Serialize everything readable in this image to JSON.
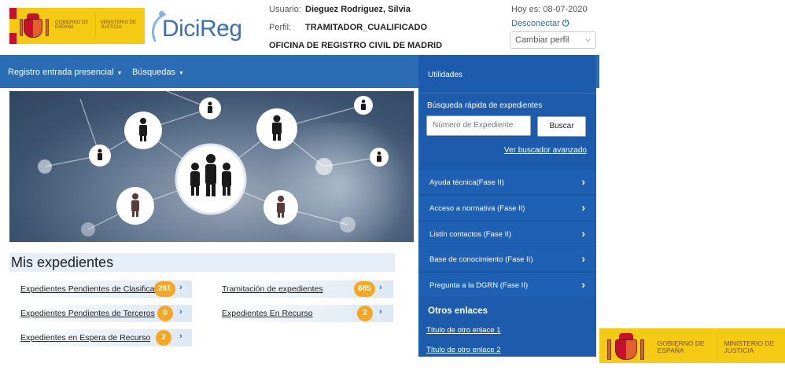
{
  "header": {
    "gov_logo": {
      "text_left": "GOBIERNO DE ESPAÑA",
      "text_right": "MINISTERIO DE JUSTICIA"
    },
    "brand": {
      "name": "DiciReg",
      "mark": "®"
    },
    "user": {
      "usuario_label": "Usuario:",
      "usuario_value": "Dieguez Rodriguez, Silvia",
      "perfil_label": "Perfil:",
      "perfil_value": "TRAMITADOR_CUALIFICADO",
      "office": "OFICINA DE REGISTRO CIVIL DE MADRID"
    },
    "date_text": "Hoy es: 08-07-2020",
    "logout_label": "Desconectar",
    "profile_select": {
      "value": "Cambiar perfil"
    }
  },
  "navbar": {
    "items": [
      {
        "label": "Registro entrada presencial"
      },
      {
        "label": "Búsquedas"
      }
    ]
  },
  "mis_expedientes": {
    "title": "Mis expedientes",
    "items": [
      {
        "label": "Expedientes Pendientes de Clasificar",
        "count": "261"
      },
      {
        "label": "Tramitación de expedientes",
        "count": "685"
      },
      {
        "label": "Expedientes Pendientes de Terceros",
        "count": "0"
      },
      {
        "label": "Expedientes En Recurso",
        "count": "2"
      },
      {
        "label": "Expedientes en Espera de Recurso",
        "count": "2"
      }
    ]
  },
  "utilidades": {
    "title": "Utilidades",
    "search_title": "Búsqueda rápida de expedientes",
    "search_placeholder": "Número de Expediente",
    "search_button": "Buscar",
    "advanced_link": "Ver buscador avanzado",
    "items": [
      {
        "label": "Ayuda técnica(Fase II)"
      },
      {
        "label": "Acceso a normativa (Fase II)"
      },
      {
        "label": "Listín contactos (Fase II)"
      },
      {
        "label": "Base de conocimiento (Fase II)"
      },
      {
        "label": "Pregunta a la DGRN (Fase II)"
      }
    ],
    "otros_title": "Otros enlaces",
    "otros_links": [
      {
        "label": "Título de otro enlace 1"
      },
      {
        "label": "Título de otro enlace 2"
      }
    ]
  },
  "colors": {
    "primary": "#2a6db5",
    "panel": "#1d5cac",
    "badge": "#f5a623",
    "gov_yellow": "#f4cb12"
  }
}
